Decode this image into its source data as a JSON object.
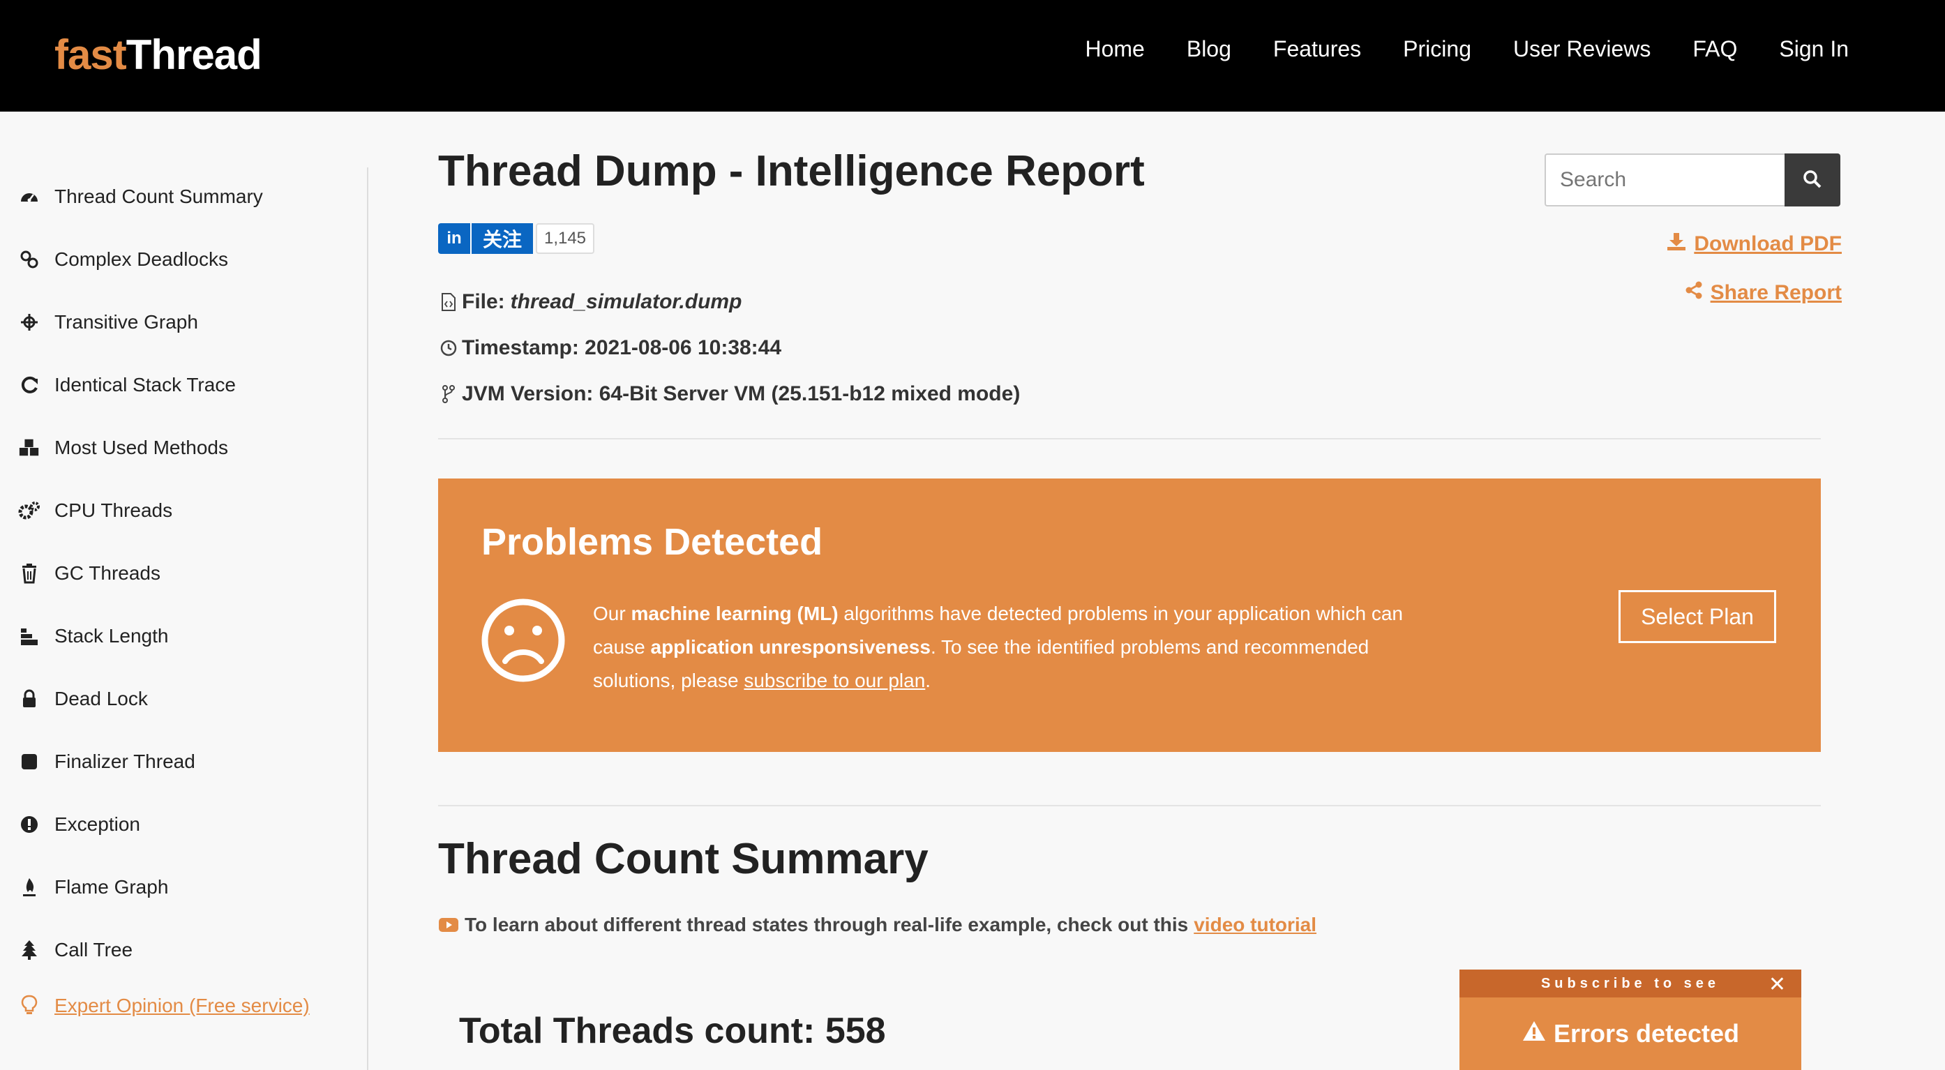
{
  "header": {
    "logo_part1": "fast",
    "logo_part2": "Thread",
    "nav": [
      "Home",
      "Blog",
      "Features",
      "Pricing",
      "User Reviews",
      "FAQ",
      "Sign In"
    ]
  },
  "sidebar": {
    "items": [
      {
        "label": "Thread Count Summary",
        "icon": "dashboard-icon"
      },
      {
        "label": "Complex Deadlocks",
        "icon": "link-icon"
      },
      {
        "label": "Transitive Graph",
        "icon": "crosshair-icon"
      },
      {
        "label": "Identical Stack Trace",
        "icon": "refresh-icon"
      },
      {
        "label": "Most Used Methods",
        "icon": "cubes-icon"
      },
      {
        "label": "CPU Threads",
        "icon": "gears-icon"
      },
      {
        "label": "GC Threads",
        "icon": "trash-icon"
      },
      {
        "label": "Stack Length",
        "icon": "stairs-icon"
      },
      {
        "label": "Dead Lock",
        "icon": "lock-icon"
      },
      {
        "label": "Finalizer Thread",
        "icon": "stop-icon"
      },
      {
        "label": "Exception",
        "icon": "exclamation-circle-icon"
      },
      {
        "label": "Flame Graph",
        "icon": "fire-icon"
      },
      {
        "label": "Call Tree",
        "icon": "tree-icon"
      }
    ],
    "expert": "Expert Opinion (Free service)"
  },
  "report": {
    "title": "Thread Dump - Intelligence Report",
    "linkedin": {
      "in": "in",
      "follow": "关注",
      "count": "1,145"
    },
    "file_label": "File:",
    "file_name": "thread_simulator.dump",
    "timestamp": "Timestamp: 2021-08-06 10:38:44",
    "jvm": "JVM Version: 64-Bit Server VM (25.151-b12 mixed mode)",
    "search_placeholder": "Search",
    "download": "Download PDF",
    "share": "Share Report"
  },
  "problems": {
    "title": "Problems Detected",
    "line1_pre": "Our ",
    "line1_b": "machine learning (ML)",
    "line1_post": " algorithms have detected problems in your application which can",
    "line2_pre": "cause ",
    "line2_b": "application unresponsiveness",
    "line2_post": ". To see the identified problems and recommended",
    "line3_pre": "solutions, please ",
    "line3_link": "subscribe to our plan",
    "line3_post": ".",
    "button": "Select Plan"
  },
  "summary": {
    "title": "Thread Count Summary",
    "tutorial_text": "To learn about different thread states through real-life example, check out this",
    "tutorial_link": "video tutorial",
    "total": "Total Threads count: 558"
  },
  "toast": {
    "top": "Subscribe to see",
    "close": "✕",
    "body": "Errors detected"
  },
  "colors": {
    "accent": "#e38b45",
    "header_bg": "#000000",
    "linkedin": "#0a66c2"
  }
}
